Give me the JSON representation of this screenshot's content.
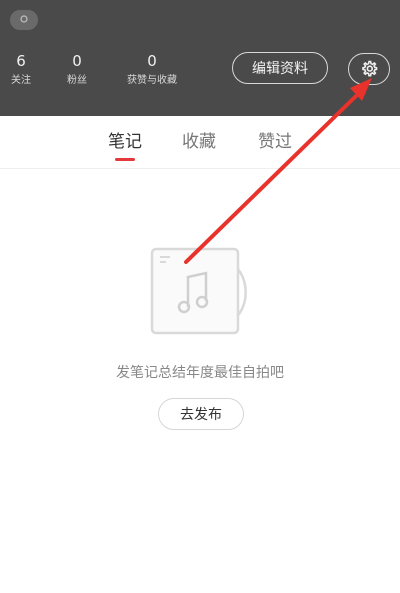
{
  "header": {
    "stats": [
      {
        "count": "6",
        "label": "关注"
      },
      {
        "count": "0",
        "label": "粉丝"
      },
      {
        "count": "0",
        "label": "获赞与收藏"
      }
    ],
    "edit_profile_label": "编辑资料"
  },
  "tabs": [
    {
      "label": "笔记",
      "active": true
    },
    {
      "label": "收藏",
      "active": false
    },
    {
      "label": "赞过",
      "active": false
    }
  ],
  "empty_state": {
    "message": "发笔记总结年度最佳自拍吧",
    "publish_label": "去发布"
  },
  "colors": {
    "header_bg": "#4a4a4a",
    "accent": "#e4393c",
    "arrow": "#e8322b"
  }
}
